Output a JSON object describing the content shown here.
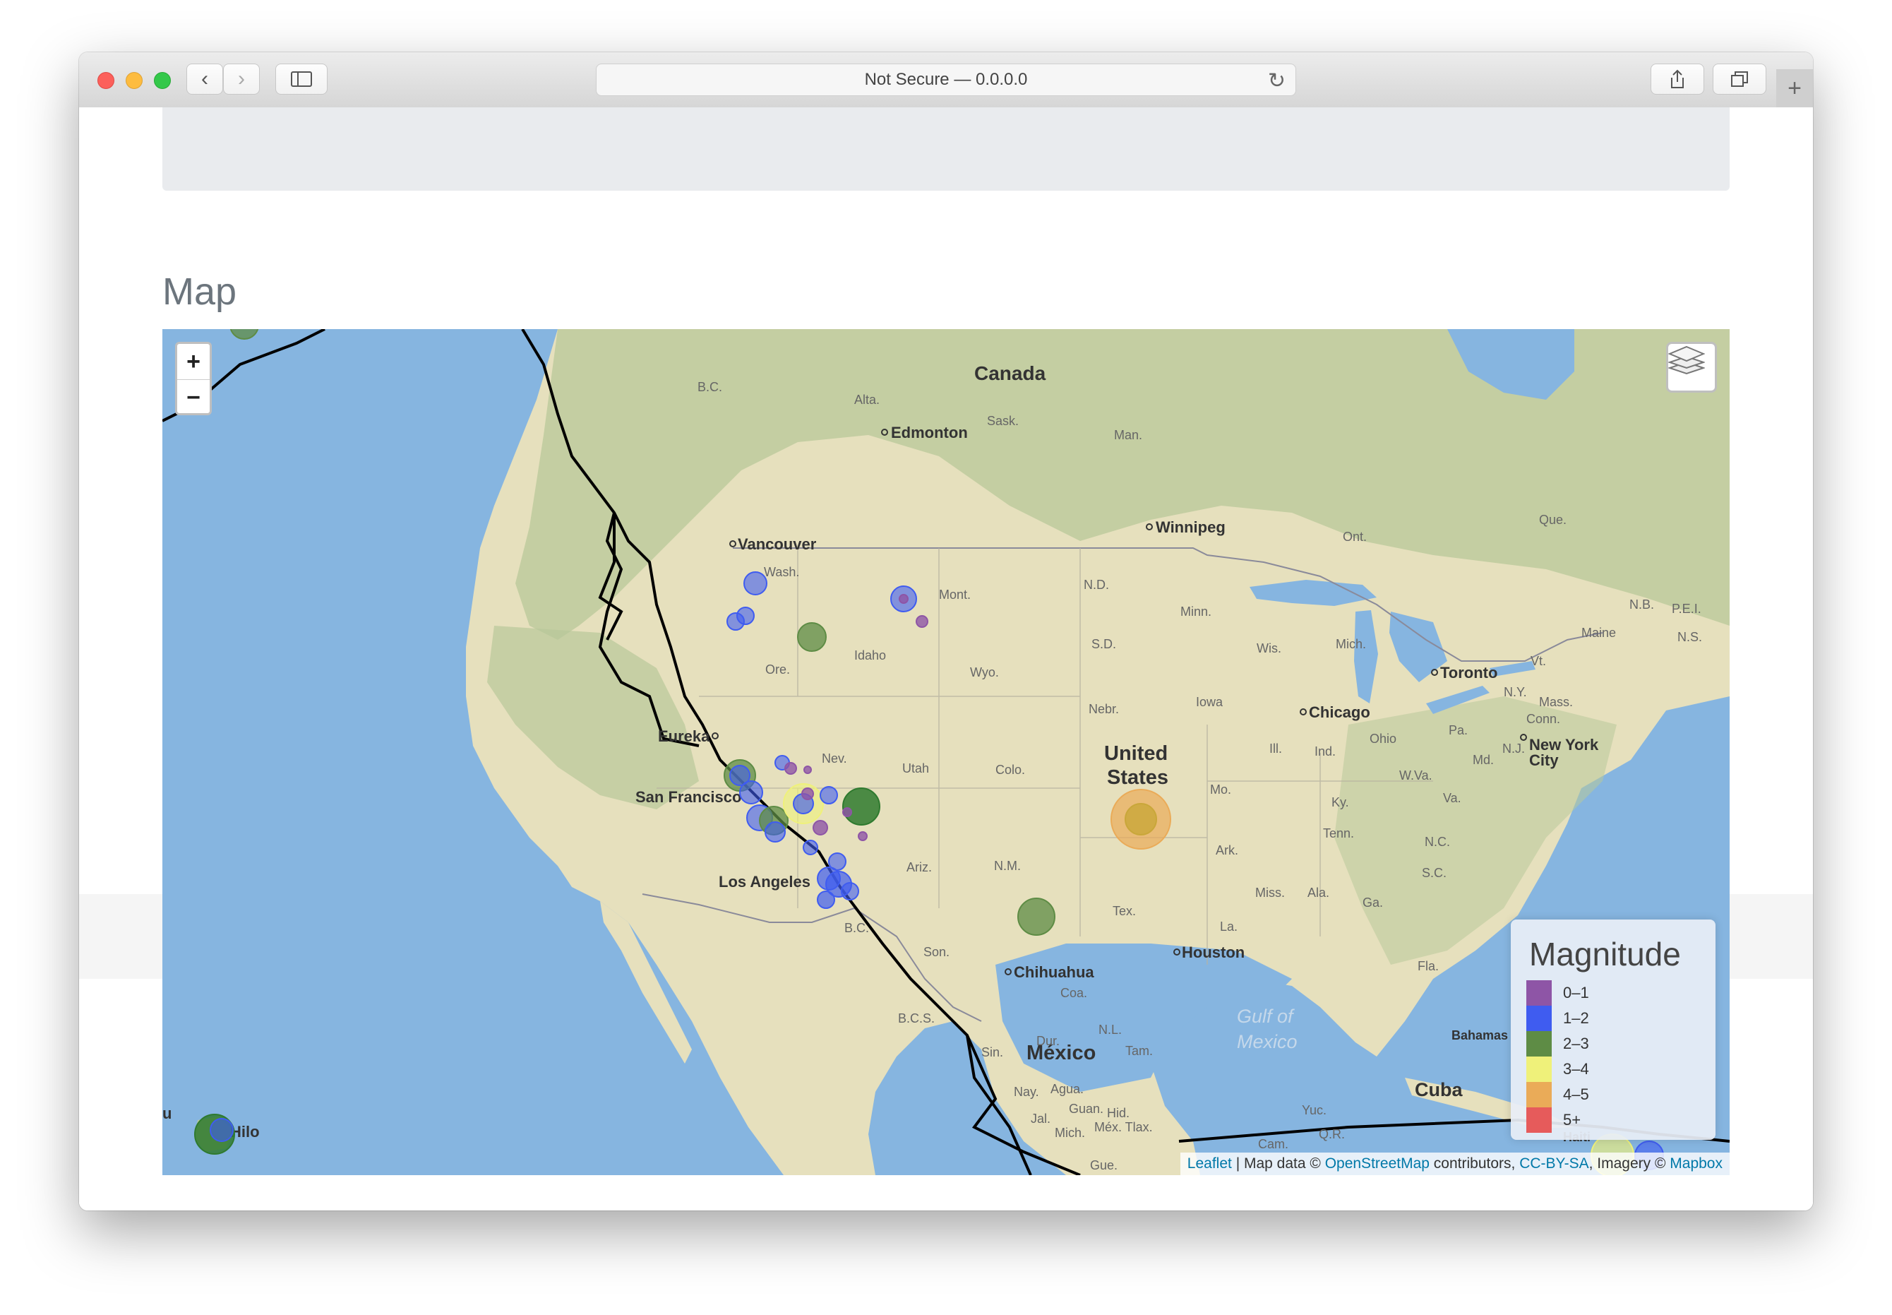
{
  "browser": {
    "address": "Not Secure — 0.0.0.0"
  },
  "page": {
    "section_title": "Map"
  },
  "map": {
    "zoom_in": "+",
    "zoom_out": "−",
    "place_labels": {
      "canada": "Canada",
      "bc": "B.C.",
      "alta": "Alta.",
      "sask": "Sask.",
      "man": "Man.",
      "ont": "Ont.",
      "que": "Que.",
      "nb": "N.B.",
      "pei": "P.E.I.",
      "ns": "N.S.",
      "maine": "Maine",
      "vt": "Vt.",
      "ny": "N.Y.",
      "mass": "Mass.",
      "conn": "Conn.",
      "nj": "N.J.",
      "md": "Md.",
      "pa": "Pa.",
      "edmonton": "Edmonton",
      "winnipeg": "Winnipeg",
      "vancouver": "Vancouver",
      "toronto": "Toronto",
      "chicago": "Chicago",
      "new_york": "New York",
      "city": "City",
      "wash": "Wash.",
      "mont": "Mont.",
      "nd": "N.D.",
      "minn": "Minn.",
      "mich": "Mich.",
      "wis": "Wis.",
      "idaho": "Idaho",
      "ore": "Ore.",
      "wyo": "Wyo.",
      "sd": "S.D.",
      "nebr": "Nebr.",
      "iowa": "Iowa",
      "ill": "Ill.",
      "ind": "Ind.",
      "ohio": "Ohio",
      "wva": "W.Va.",
      "va": "Va.",
      "nev": "Nev.",
      "utah": "Utah",
      "colo": "Colo.",
      "eureka": "Eureka",
      "san_francisco": "San Francisco",
      "los_angeles": "Los Angeles",
      "united": "United",
      "states": "States",
      "mo": "Mo.",
      "ky": "Ky.",
      "tenn": "Tenn.",
      "nc": "N.C.",
      "sc": "S.C.",
      "ark": "Ark.",
      "ariz": "Ariz.",
      "nm": "N.M.",
      "tex": "Tex.",
      "la": "La.",
      "miss": "Miss.",
      "ala": "Ala.",
      "ga": "Ga.",
      "fla": "Fla.",
      "houston": "Houston",
      "chihuahua": "Chihuahua",
      "son": "Son.",
      "coa": "Coa.",
      "bc_mx": "B.C.",
      "bcs": "B.C.S.",
      "mexico": "México",
      "gulf1": "Gulf of",
      "gulf2": "Mexico",
      "bahamas": "Bahamas",
      "cuba": "Cuba",
      "haiti": "Haiti",
      "hilo": "Hilo",
      "hawaii_u": "u",
      "dur": "Dur.",
      "sin": "Sin.",
      "nl": "N.L.",
      "tam": "Tam.",
      "nay": "Nay.",
      "agua": "Agua.",
      "guan": "Guan.",
      "hid": "Hid.",
      "mich_mx": "Mich.",
      "mex_tlax": "Méx. Tlax.",
      "jal": "Jal.",
      "gue": "Gue.",
      "yuc": "Yuc.",
      "qr": "Q.R.",
      "cam": "Cam."
    },
    "colors": {
      "water": "#86b5e0",
      "land": "#e6e0bd",
      "plates": "#000000"
    },
    "earthquakes": [
      {
        "place": "Washington",
        "magnitude_class": "1–2"
      },
      {
        "place": "Washington coast",
        "magnitude_class": "1–2"
      },
      {
        "place": "Montana",
        "magnitude_class": "1–2"
      },
      {
        "place": "Montana",
        "magnitude_class": "0–1"
      },
      {
        "place": "Idaho",
        "magnitude_class": "2–3"
      },
      {
        "place": "Northern California",
        "magnitude_class": "2–3"
      },
      {
        "place": "Nevada",
        "magnitude_class": "2–3"
      },
      {
        "place": "California",
        "magnitude_class": "3–4"
      },
      {
        "place": "Southern California",
        "magnitude_class": "1–2"
      },
      {
        "place": "New Mexico/Texas",
        "magnitude_class": "2–3"
      },
      {
        "place": "Kansas/Oklahoma",
        "magnitude_class": "4–5"
      },
      {
        "place": "Hawaii",
        "magnitude_class": "2–3"
      },
      {
        "place": "Puerto Rico",
        "magnitude_class": "3–4"
      }
    ]
  },
  "legend": {
    "title": "Magnitude",
    "items": [
      {
        "label": "0–1",
        "color": "#8e55a6"
      },
      {
        "label": "1–2",
        "color": "#3f5cf0"
      },
      {
        "label": "2–3",
        "color": "#5e8c45"
      },
      {
        "label": "3–4",
        "color": "#eff17a"
      },
      {
        "label": "4–5",
        "color": "#eaab58"
      },
      {
        "label": "5+",
        "color": "#e65b5b"
      }
    ]
  },
  "attribution": {
    "leaflet": "Leaflet",
    "sep1": " | Map data © ",
    "osm": "OpenStreetMap",
    "contributors": " contributors, ",
    "ccbysa": "CC-BY-SA",
    "imagery": ", Imagery © ",
    "mapbox": "Mapbox"
  }
}
